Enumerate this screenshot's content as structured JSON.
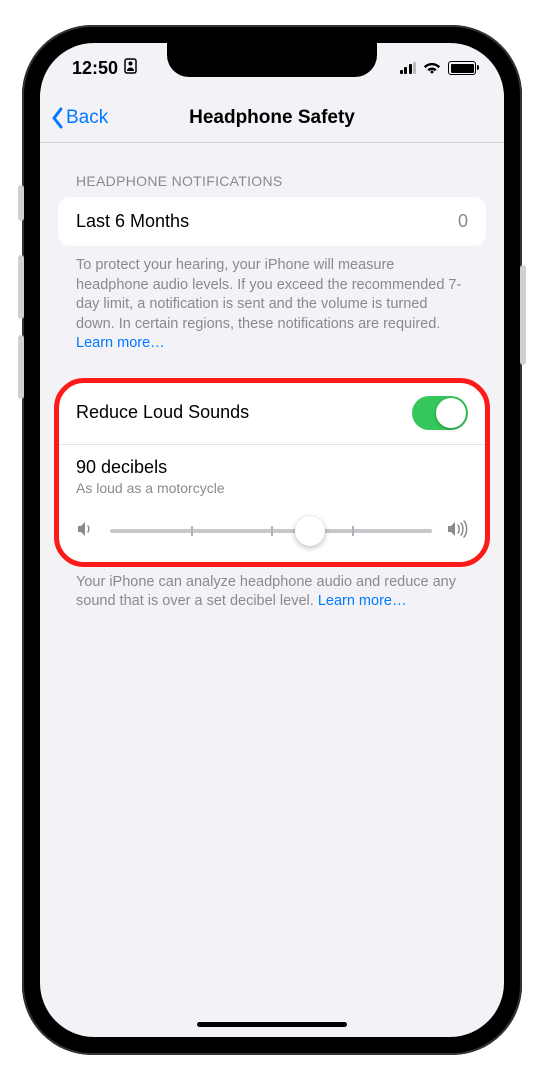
{
  "status": {
    "time": "12:50"
  },
  "nav": {
    "back_label": "Back",
    "title": "Headphone Safety"
  },
  "section1": {
    "header": "HEADPHONE NOTIFICATIONS",
    "row_label": "Last 6 Months",
    "row_value": "0",
    "footer": "To protect your hearing, your iPhone will measure headphone audio levels. If you exceed the recommended 7-day limit, a notification is sent and the volume is turned down. In certain regions, these notifications are required. ",
    "footer_link": "Learn more…"
  },
  "section2": {
    "toggle_label": "Reduce Loud Sounds",
    "db_label": "90 decibels",
    "db_sub": "As loud as a motorcycle",
    "footer": "Your iPhone can analyze headphone audio and reduce any sound that is over a set decibel level. ",
    "footer_link": "Learn more…"
  }
}
